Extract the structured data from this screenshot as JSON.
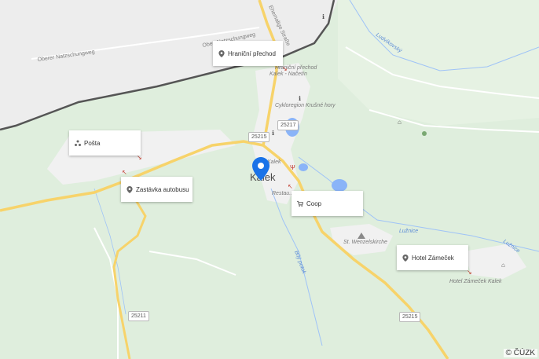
{
  "map": {
    "town": "Kalek",
    "road_labels": [
      "Oberer Natzschungweg",
      "Ober. Natzschungweg",
      "Ehemalige Straße"
    ],
    "water_labels": [
      "Ludvíkovský",
      "Lužnice",
      "Bílý potok",
      "Lužnice"
    ],
    "place_labels": [
      "Hraniční přechod",
      "Kalek - Načetín",
      "Cykloregion Krušné hory",
      "Restau...",
      "St. Wenzelskirche",
      "Hotel Zámeček Kalek",
      "Kalek"
    ],
    "road_shields": [
      "25217",
      "25215",
      "25211",
      "25215"
    ],
    "attribution": "© ČÚZK",
    "colors": {
      "land": "#dfeedd",
      "urban": "#f1f1f1",
      "road_major": "#f7d36a",
      "water": "#8ab4f8",
      "border": "#555555",
      "pin": "#1a73e8"
    }
  },
  "pois": [
    {
      "label": "Hraniční přechod",
      "icon": "pin-icon"
    },
    {
      "label": "Pošta",
      "icon": "post-icon"
    },
    {
      "label": "Zastávka autobusu",
      "icon": "pin-icon"
    },
    {
      "label": "Coop",
      "icon": "cart-icon"
    },
    {
      "label": "Hotel Zámeček",
      "icon": "pin-icon"
    }
  ]
}
